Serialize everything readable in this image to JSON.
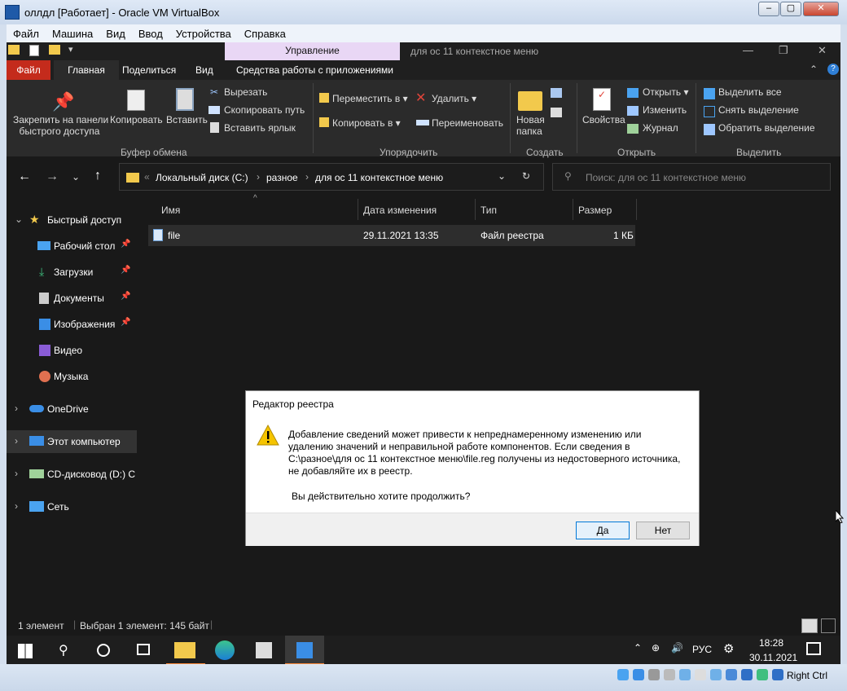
{
  "host": {
    "title": "оллдл [Работает] - Oracle VM VirtualBox",
    "menu": [
      "Файл",
      "Машина",
      "Вид",
      "Ввод",
      "Устройства",
      "Справка"
    ],
    "host_key": "Right Ctrl"
  },
  "explorer": {
    "context_tab": "Управление",
    "window_path": "для ос 11 контекстное меню",
    "tabs": {
      "file": "Файл",
      "home": "Главная",
      "share": "Поделиться",
      "view": "Вид",
      "app_tools": "Средства работы с приложениями"
    },
    "ribbon": {
      "pin": "Закрепить на панели быстрого доступа",
      "pin_l1": "Закрепить на панели",
      "pin_l2": "быстрого доступа",
      "copy": "Копировать",
      "paste": "Вставить",
      "cut": "Вырезать",
      "copy_path": "Скопировать путь",
      "paste_shortcut": "Вставить ярлык",
      "clipboard_group": "Буфер обмена",
      "move_to": "Переместить в",
      "copy_to": "Копировать в",
      "delete": "Удалить",
      "rename": "Переименовать",
      "organize_group": "Упорядочить",
      "new_folder_l1": "Новая",
      "new_folder_l2": "папка",
      "create_group": "Создать",
      "properties": "Свойства",
      "open": "Открыть",
      "edit": "Изменить",
      "history": "Журнал",
      "open_group": "Открыть",
      "select_all": "Выделить все",
      "select_none": "Снять выделение",
      "invert_selection": "Обратить выделение",
      "select_group": "Выделить"
    },
    "address": {
      "crumbs": [
        "Локальный диск (C:)",
        "разное",
        "для ос 11 контекстное меню"
      ],
      "search_placeholder": "Поиск: для ос 11 контекстное меню"
    },
    "sidebar": {
      "quick_access": "Быстрый доступ",
      "items": [
        "Рабочий стол",
        "Загрузки",
        "Документы",
        "Изображения",
        "Видео",
        "Музыка"
      ],
      "onedrive": "OneDrive",
      "this_pc": "Этот компьютер",
      "cd": "CD-дисковод (D:) C",
      "network": "Сеть"
    },
    "columns": {
      "name": "Имя",
      "date": "Дата изменения",
      "type": "Тип",
      "size": "Размер"
    },
    "files": [
      {
        "name": "file",
        "date": "29.11.2021 13:35",
        "type": "Файл реестра",
        "size": "1 КБ"
      }
    ],
    "status": {
      "count": "1 элемент",
      "selected": "Выбран 1 элемент: 145 байт"
    }
  },
  "dialog": {
    "title": "Редактор реестра",
    "message": "Добавление сведений может привести к непреднамеренному изменению или удалению значений и неправильной работе компонентов. Если сведения в C:\\разное\\для ос 11 контекстное меню\\file.reg получены из недостоверного источника, не добавляйте их в реестр.",
    "question": "Вы действительно хотите продолжить?",
    "yes": "Да",
    "no": "Нет"
  },
  "taskbar": {
    "lang": "РУС",
    "time": "18:28",
    "date": "30.11.2021"
  },
  "colors": {
    "accent_red": "#c42b1c",
    "context_tab": "#e9d7f5",
    "warning": "#f5c400"
  }
}
